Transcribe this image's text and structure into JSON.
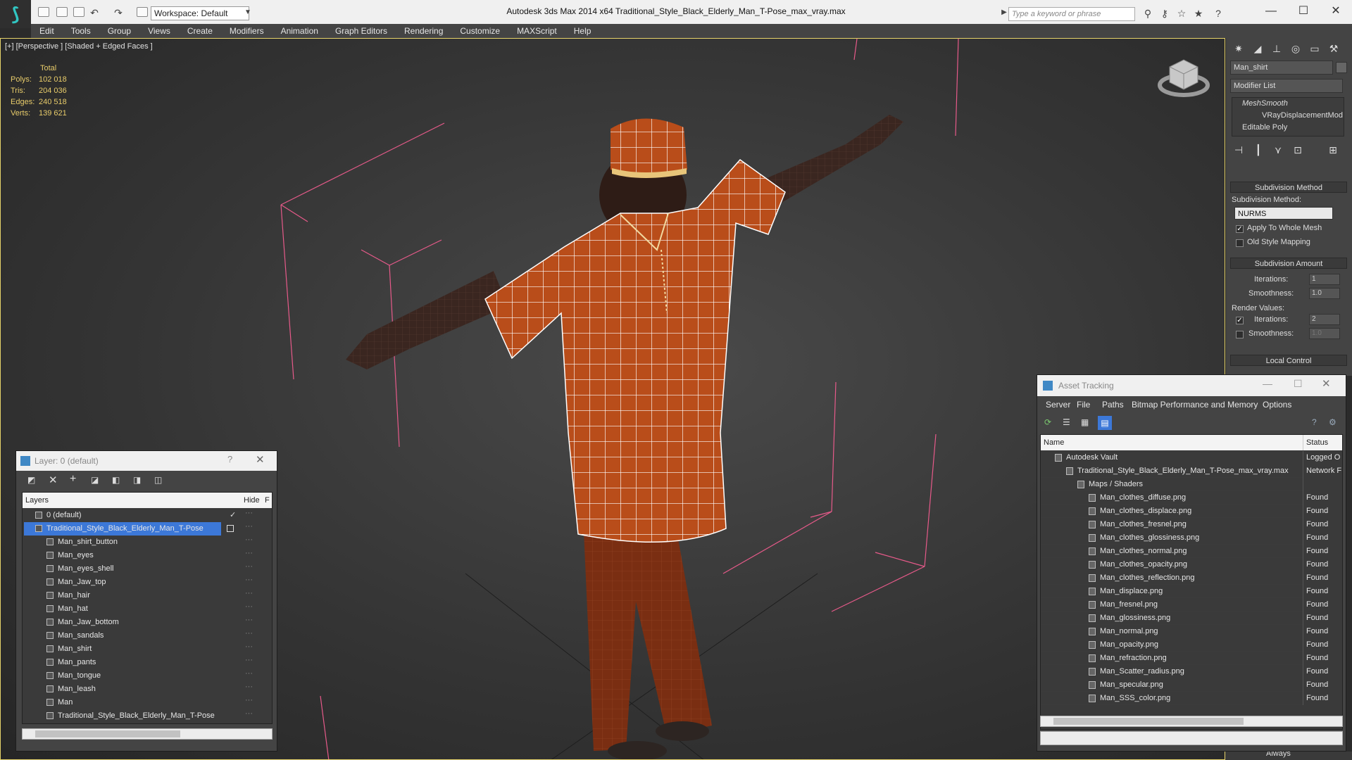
{
  "window": {
    "title": "Autodesk 3ds Max  2014 x64     Traditional_Style_Black_Elderly_Man_T-Pose_max_vray.max",
    "workspace": "Workspace: Default",
    "search_placeholder": "Type a keyword or phrase"
  },
  "menu": [
    "Edit",
    "Tools",
    "Group",
    "Views",
    "Create",
    "Modifiers",
    "Animation",
    "Graph Editors",
    "Rendering",
    "Customize",
    "MAXScript",
    "Help"
  ],
  "viewport": {
    "label": "[+] [Perspective ] [Shaded + Edged Faces ]",
    "stats": {
      "header": "Total",
      "rows": [
        {
          "label": "Polys:",
          "value": "102 018"
        },
        {
          "label": "Tris:",
          "value": "204 036"
        },
        {
          "label": "Edges:",
          "value": "240 518"
        },
        {
          "label": "Verts:",
          "value": "139 621"
        }
      ]
    }
  },
  "command_panel": {
    "object_name": "Man_shirt",
    "modifier_list": "Modifier List",
    "stack": [
      "MeshSmooth",
      "VRayDisplacementMod",
      "Editable Poly"
    ],
    "subdivision_method_title": "Subdivision Method",
    "subdivision_method_label": "Subdivision Method:",
    "subdivision_method_value": "NURMS",
    "apply_whole_mesh": "Apply To Whole Mesh",
    "old_style_mapping": "Old Style Mapping",
    "subdivision_amount_title": "Subdivision Amount",
    "iterations_label": "Iterations:",
    "iterations_value": "1",
    "smoothness_label": "Smoothness:",
    "smoothness_value": "1.0",
    "render_values": "Render Values:",
    "render_iterations_value": "2",
    "render_smoothness_value": "1.0",
    "local_control_title": "Local Control",
    "always": "Always"
  },
  "layer_dialog": {
    "title": "Layer: 0 (default)",
    "col_layers": "Layers",
    "col_hide": "Hide",
    "col_f": "F",
    "rows": [
      {
        "name": "0 (default)",
        "level": 0,
        "checked": true
      },
      {
        "name": "Traditional_Style_Black_Elderly_Man_T-Pose",
        "level": 0,
        "selected": true
      },
      {
        "name": "Man_shirt_button",
        "level": 1
      },
      {
        "name": "Man_eyes",
        "level": 1
      },
      {
        "name": "Man_eyes_shell",
        "level": 1
      },
      {
        "name": "Man_Jaw_top",
        "level": 1
      },
      {
        "name": "Man_hair",
        "level": 1
      },
      {
        "name": "Man_hat",
        "level": 1
      },
      {
        "name": "Man_Jaw_bottom",
        "level": 1
      },
      {
        "name": "Man_sandals",
        "level": 1
      },
      {
        "name": "Man_shirt",
        "level": 1
      },
      {
        "name": "Man_pants",
        "level": 1
      },
      {
        "name": "Man_tongue",
        "level": 1
      },
      {
        "name": "Man_leash",
        "level": 1
      },
      {
        "name": "Man",
        "level": 1
      },
      {
        "name": "Traditional_Style_Black_Elderly_Man_T-Pose",
        "level": 1
      }
    ]
  },
  "asset_dialog": {
    "title": "Asset Tracking",
    "menu": [
      "Server",
      "File",
      "Paths",
      "Bitmap Performance and Memory",
      "Options"
    ],
    "col_name": "Name",
    "col_status": "Status",
    "rows": [
      {
        "name": "Autodesk Vault",
        "level": 0,
        "status": "Logged O"
      },
      {
        "name": "Traditional_Style_Black_Elderly_Man_T-Pose_max_vray.max",
        "level": 1,
        "status": "Network F"
      },
      {
        "name": "Maps / Shaders",
        "level": 2,
        "status": ""
      },
      {
        "name": "Man_clothes_diffuse.png",
        "level": 3,
        "status": "Found"
      },
      {
        "name": "Man_clothes_displace.png",
        "level": 3,
        "status": "Found"
      },
      {
        "name": "Man_clothes_fresnel.png",
        "level": 3,
        "status": "Found"
      },
      {
        "name": "Man_clothes_glossiness.png",
        "level": 3,
        "status": "Found"
      },
      {
        "name": "Man_clothes_normal.png",
        "level": 3,
        "status": "Found"
      },
      {
        "name": "Man_clothes_opacity.png",
        "level": 3,
        "status": "Found"
      },
      {
        "name": "Man_clothes_reflection.png",
        "level": 3,
        "status": "Found"
      },
      {
        "name": "Man_displace.png",
        "level": 3,
        "status": "Found"
      },
      {
        "name": "Man_fresnel.png",
        "level": 3,
        "status": "Found"
      },
      {
        "name": "Man_glossiness.png",
        "level": 3,
        "status": "Found"
      },
      {
        "name": "Man_normal.png",
        "level": 3,
        "status": "Found"
      },
      {
        "name": "Man_opacity.png",
        "level": 3,
        "status": "Found"
      },
      {
        "name": "Man_refraction.png",
        "level": 3,
        "status": "Found"
      },
      {
        "name": "Man_Scatter_radius.png",
        "level": 3,
        "status": "Found"
      },
      {
        "name": "Man_specular.png",
        "level": 3,
        "status": "Found"
      },
      {
        "name": "Man_SSS_color.png",
        "level": 3,
        "status": "Found"
      }
    ]
  },
  "colors": {
    "selection": "#3c78d8",
    "stats_text": "#e8cc6a",
    "accent": "#31c6c2"
  }
}
